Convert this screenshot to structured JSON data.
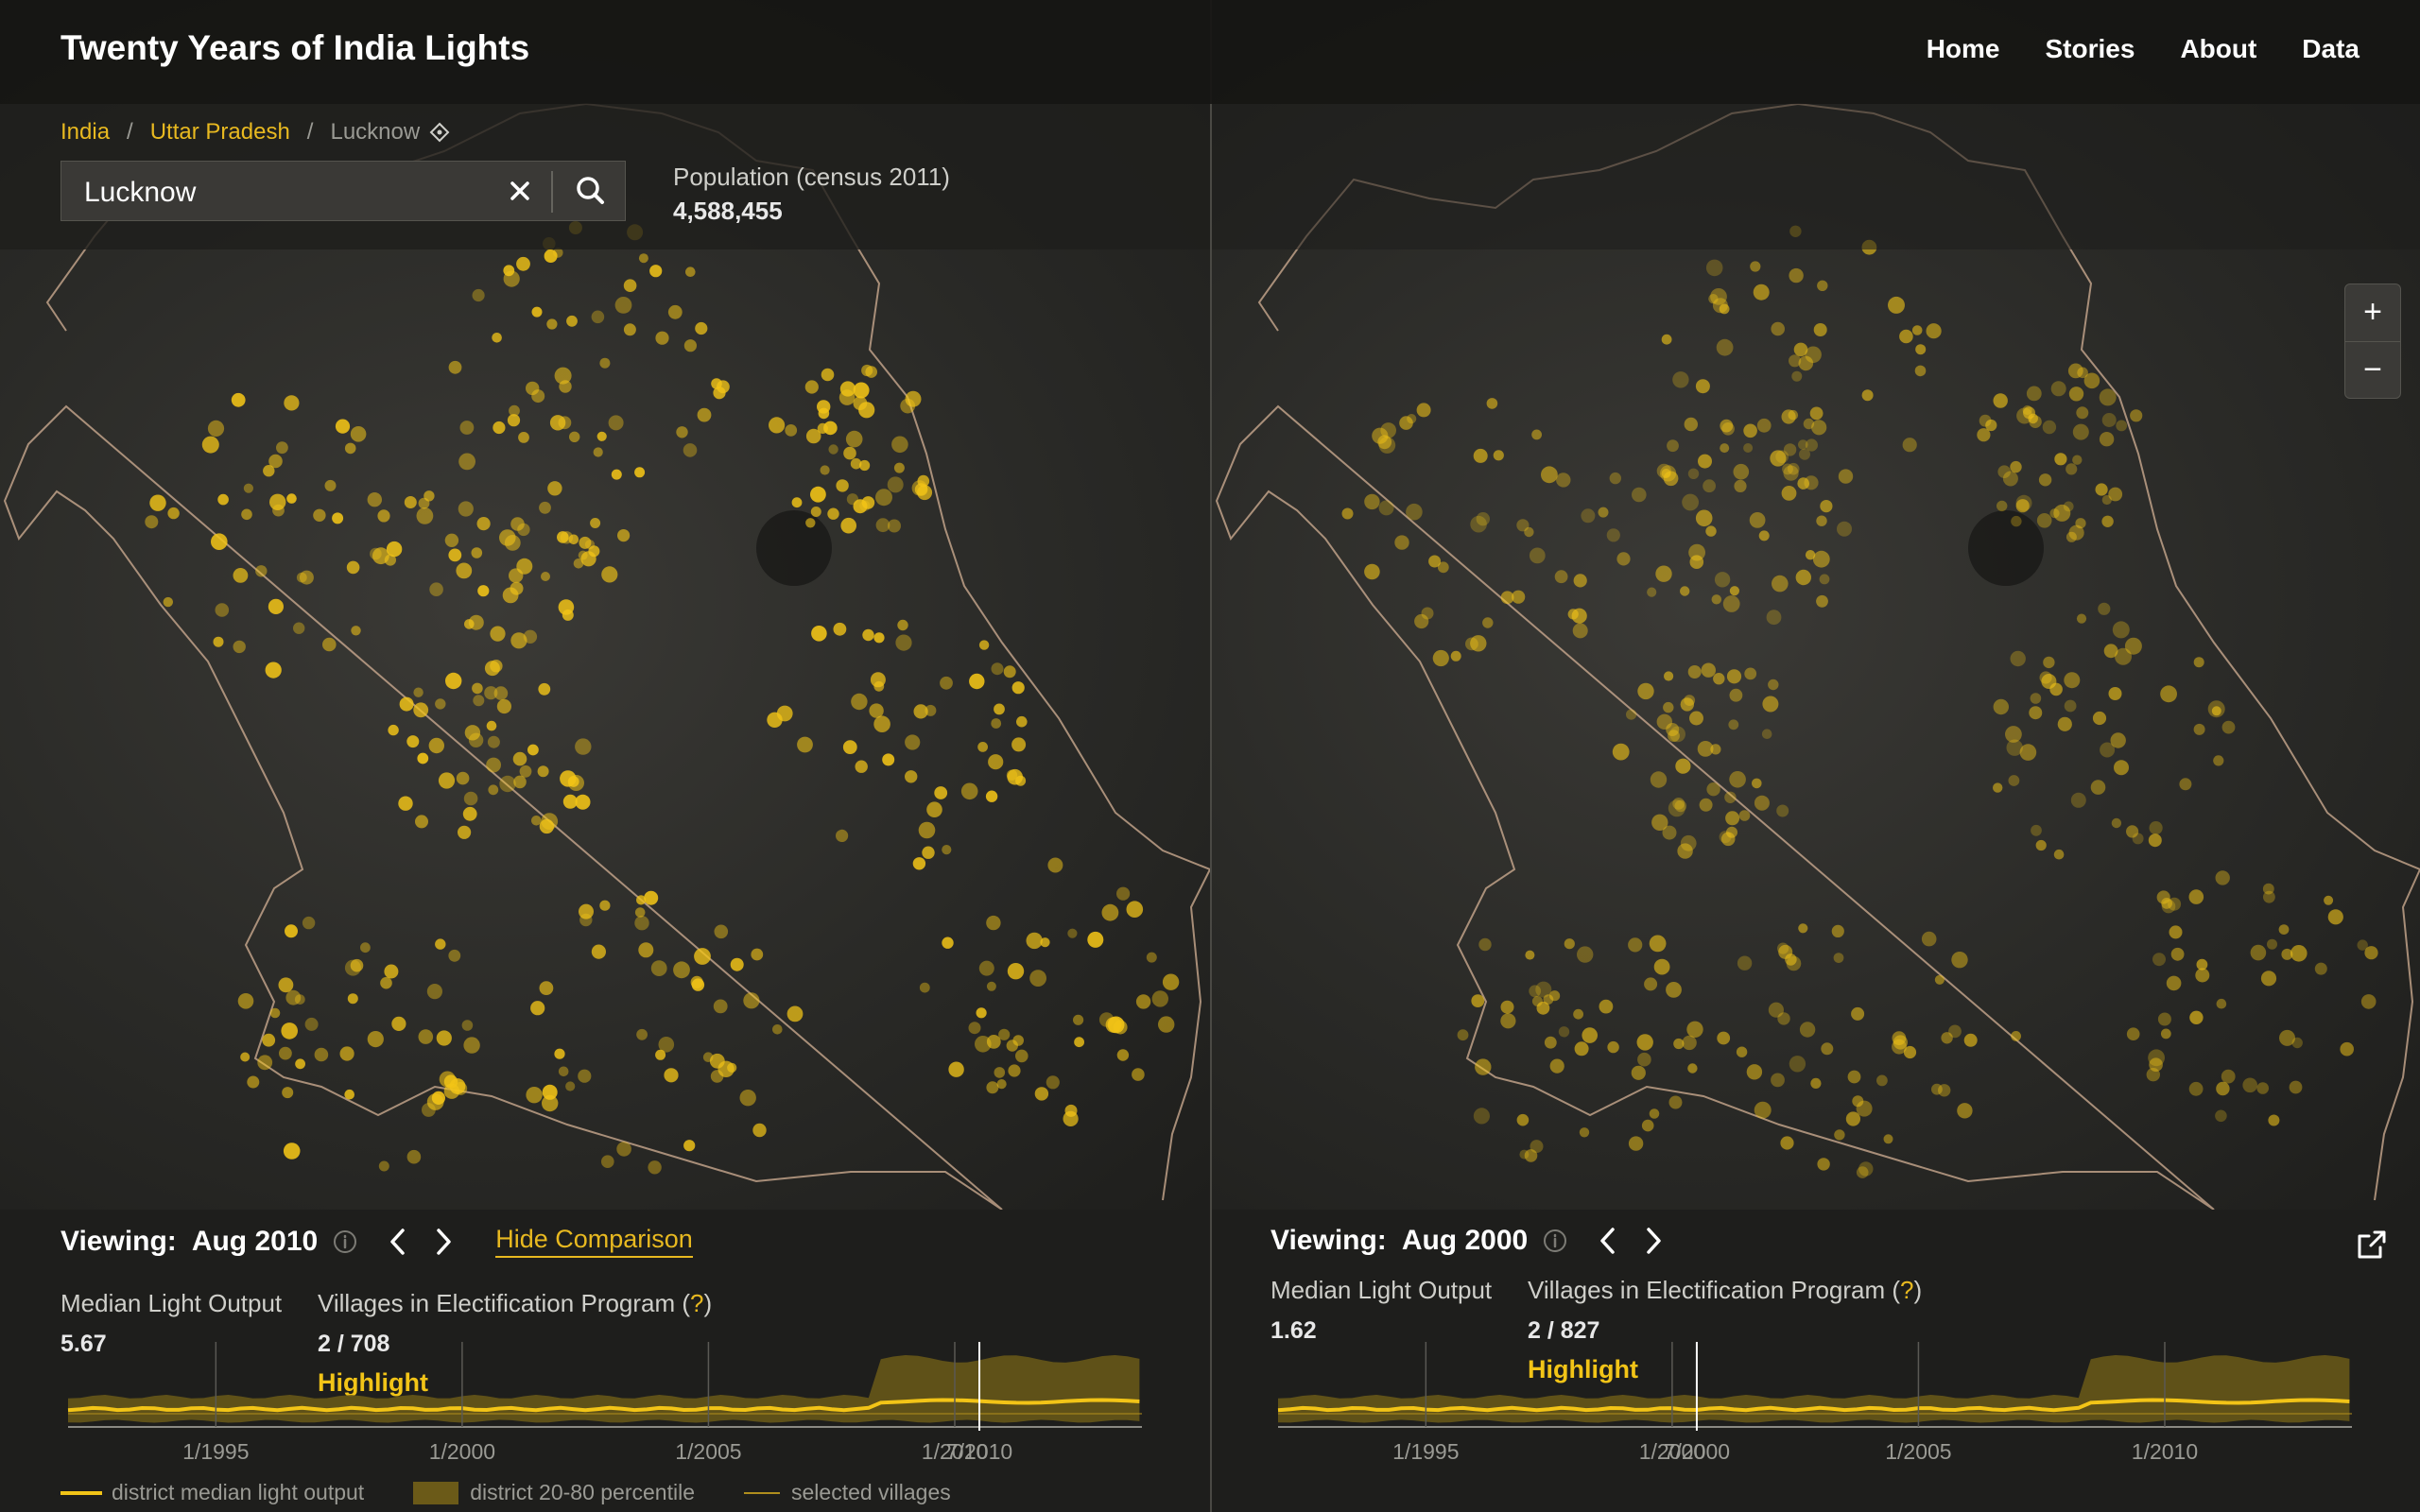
{
  "app": {
    "title": "Twenty Years of India Lights"
  },
  "nav": {
    "items": [
      "Home",
      "Stories",
      "About",
      "Data"
    ]
  },
  "breadcrumb": {
    "country": "India",
    "state": "Uttar Pradesh",
    "district": "Lucknow"
  },
  "search": {
    "value": "Lucknow"
  },
  "population": {
    "label": "Population (census 2011)",
    "value": "4,588,455"
  },
  "zoom": {
    "in": "+",
    "out": "−"
  },
  "panels": {
    "left": {
      "viewing_label": "Viewing:",
      "date": "Aug 2010",
      "hide_comparison": "Hide Comparison",
      "median_label": "Median Light Output",
      "median_value": "5.67",
      "villages_label": "Villages in Electification Program (",
      "villages_q": "?",
      "villages_close": ")",
      "villages_value": "2 / 708",
      "highlight": "Highlight",
      "ticks": [
        "1/1995",
        "1/2000",
        "1/2005",
        "1/2010"
      ],
      "cursor_label": "7/2010"
    },
    "right": {
      "viewing_label": "Viewing:",
      "date": "Aug 2000",
      "median_label": "Median Light Output",
      "median_value": "1.62",
      "villages_label": "Villages in Electification Program (",
      "villages_q": "?",
      "villages_close": ")",
      "villages_value": "2 / 827",
      "highlight": "Highlight",
      "ticks": [
        "1/1995",
        "1/2000",
        "1/2005",
        "1/2010"
      ],
      "cursor_label": "7/2000"
    }
  },
  "legend": {
    "median": "district median light output",
    "percentile": "district 20-80 percentile",
    "villages": "selected villages"
  },
  "colors": {
    "accent": "#e8b920",
    "light": "#f2c417",
    "band": "#6b5a18",
    "background": "#1e1e1c"
  },
  "icons": [
    "search-icon",
    "close-icon",
    "target-icon",
    "info-icon",
    "chevron-left-icon",
    "chevron-right-icon",
    "external-link-icon",
    "plus-icon",
    "minus-icon"
  ]
}
